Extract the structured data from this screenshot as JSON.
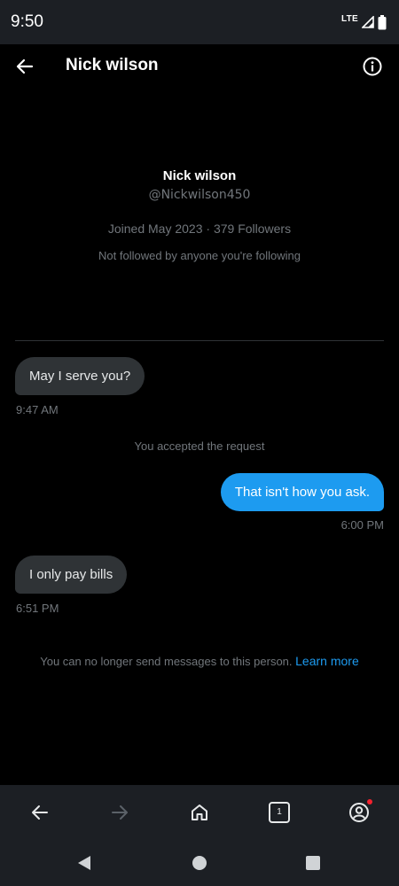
{
  "status_bar": {
    "time": "9:50",
    "network": "LTE"
  },
  "header": {
    "title": "Nick wilson"
  },
  "profile": {
    "name": "Nick wilson",
    "handle": "@Nickwilson450",
    "meta": "Joined May 2023 · 379 Followers",
    "follow_note": "Not followed by anyone you're following"
  },
  "messages": [
    {
      "direction": "incoming",
      "text": "May I serve you?",
      "time": "9:47 AM"
    },
    {
      "direction": "system",
      "text": "You accepted the request"
    },
    {
      "direction": "outgoing",
      "text": "That isn't how you ask.",
      "time": "6:00 PM"
    },
    {
      "direction": "incoming",
      "text": "I only pay bills",
      "time": "6:51 PM"
    }
  ],
  "footer_notice": {
    "text": "You can no longer send messages to this person.",
    "link": "Learn more"
  },
  "browser_bar": {
    "tab_count": "1"
  },
  "colors": {
    "accent": "#1d9bf0",
    "bubble_incoming": "#2f3336",
    "notification_dot": "#f4212e"
  }
}
